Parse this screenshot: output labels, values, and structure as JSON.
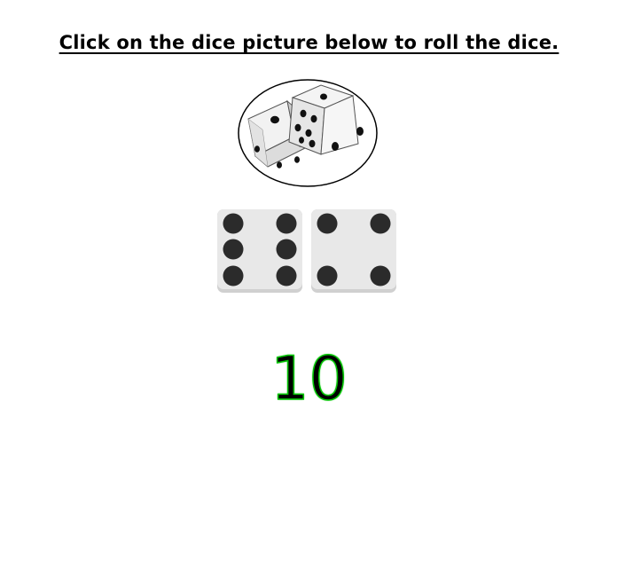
{
  "instruction": "Click on the dice picture below to roll the dice.",
  "roll_image": {
    "icon": "two-dice-icon"
  },
  "dice": [
    {
      "value": 6,
      "icon": "die-face-six-icon"
    },
    {
      "value": 4,
      "icon": "die-face-four-icon"
    }
  ],
  "total": "10",
  "colors": {
    "total_outline": "#00c400",
    "pip": "#2b2b2b",
    "die_face": "#e8e8e8"
  }
}
